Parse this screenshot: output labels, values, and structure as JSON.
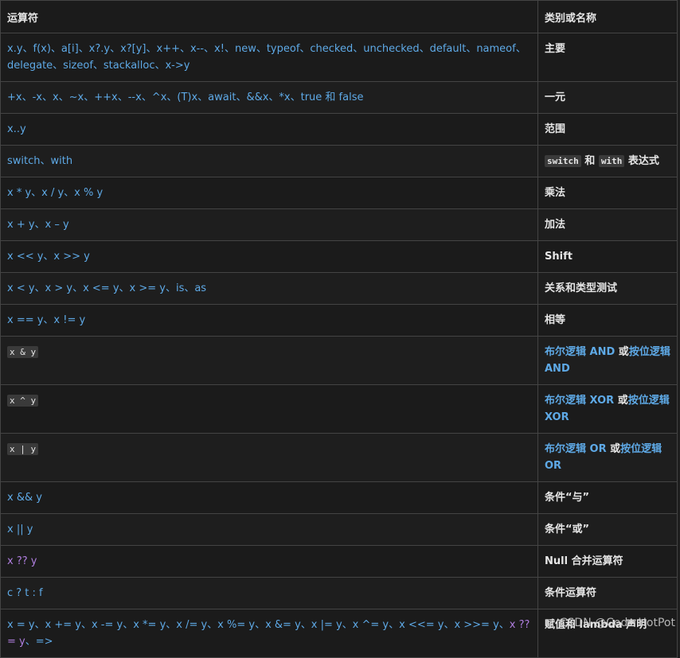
{
  "headers": [
    "运算符",
    "类别或名称"
  ],
  "rows": [
    {
      "op": "x.y、f(x)、a[i]、x?.y、x?[y]、x++、x--、x!、new、typeof、checked、unchecked、default、nameof、delegate、sizeof、stackalloc、x->y",
      "cat": "主要"
    },
    {
      "op": "+x、-x、x、~x、++x、--x、^x、(T)x、await、&&x、*x、true 和 false",
      "cat": "一元"
    },
    {
      "op": "x..y",
      "cat": "范围"
    },
    {
      "op": "switch、with",
      "cat_code1": "switch",
      "cat_mid": "和",
      "cat_code2": "with",
      "cat_tail": "表达式"
    },
    {
      "op": "x * y、x / y、x % y",
      "cat": "乘法"
    },
    {
      "op": "x + y、x – y",
      "cat": "加法"
    },
    {
      "op": "x << y、x >> y",
      "cat": "Shift"
    },
    {
      "op": "x < y、x > y、x <= y、x >= y、is、as",
      "cat": "关系和类型测试"
    },
    {
      "op": "x == y、x != y",
      "cat": "相等"
    },
    {
      "op_code": "x & y",
      "cat_link1": "布尔逻辑 AND",
      "cat_mid": "或",
      "cat_link2": "按位逻辑 AND"
    },
    {
      "op_code": "x ^ y",
      "cat_link1": "布尔逻辑 XOR",
      "cat_mid": "或",
      "cat_link2": "按位逻辑 XOR"
    },
    {
      "op_code": "x | y",
      "cat_link1": "布尔逻辑 OR",
      "cat_mid": "或",
      "cat_link2": "按位逻辑 OR"
    },
    {
      "op": "x && y",
      "cat": "条件“与”"
    },
    {
      "op": "x || y",
      "cat": "条件“或”"
    },
    {
      "op": "x ?? y",
      "cat": "Null 合并运算符"
    },
    {
      "op": "c ? t : f",
      "cat": "条件运算符"
    },
    {
      "op_a": "x = y、x += y、x -= y、x *= y、x /= y、x %= y、x &= y、x |= y、x ^= y、x <<= y、x >>= y、",
      "op_b": "x ??= y",
      "op_c": "、=>",
      "cat": "赋值和 lambda 声明"
    }
  ],
  "colors": {
    "link": "#5ea9e6",
    "keyword_purple": "#b07fe0",
    "background": "#1e1e1e"
  },
  "watermark": "CSDN @Code HotPot"
}
